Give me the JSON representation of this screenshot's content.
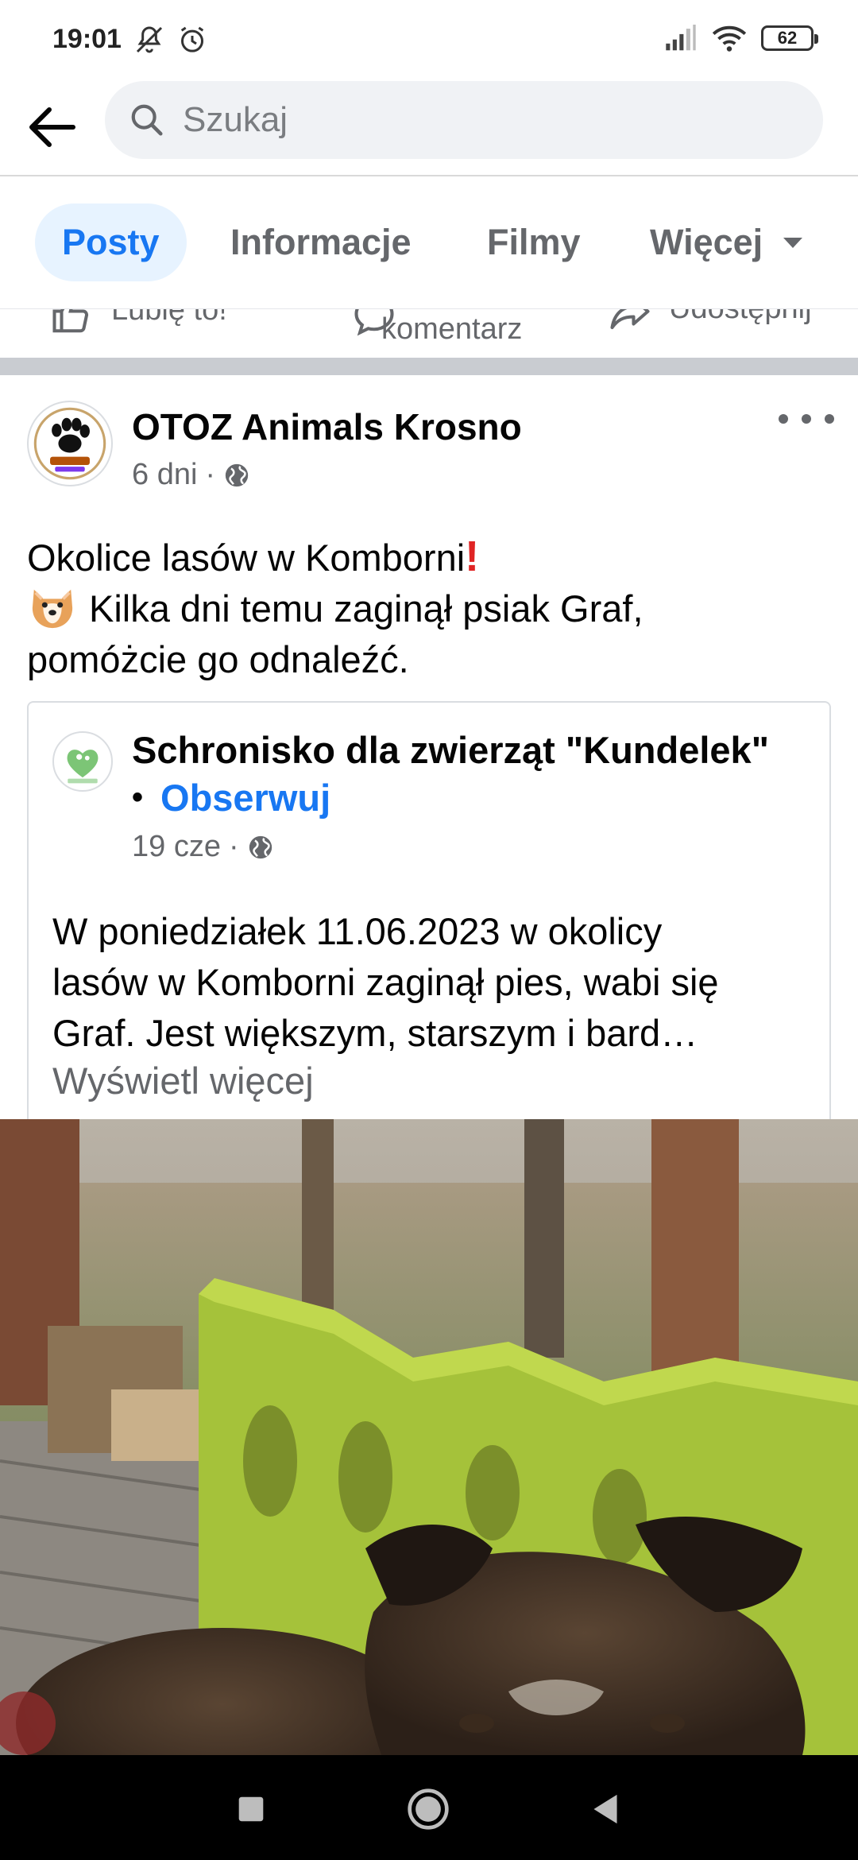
{
  "status_bar": {
    "time": "19:01",
    "battery": "62",
    "icons": [
      "mute-icon",
      "alarm-icon",
      "signal-icon",
      "wifi-icon",
      "battery-icon"
    ]
  },
  "search": {
    "placeholder": "Szukaj"
  },
  "tabs": [
    {
      "label": "Posty",
      "active": true
    },
    {
      "label": "Informacje",
      "active": false
    },
    {
      "label": "Filmy",
      "active": false
    },
    {
      "label": "Więcej",
      "active": false
    }
  ],
  "actions": {
    "like": "Lubię to!",
    "comment": "komentarz",
    "share": "Udostępnij"
  },
  "post": {
    "author": "OTOZ Animals Krosno",
    "time": "6 dni",
    "text_lines": [
      "Okolice lasów w Komborni",
      "Kilka dni temu zaginął psiak Graf,",
      "pomóżcie go odnaleźć."
    ],
    "shared": {
      "author": "Schronisko dla zwierząt \"Kundelek\"",
      "follow": "Obserwuj",
      "separator": "•",
      "time": "19 cze",
      "text_lines": [
        "W poniedziałek 11.06.2023 w okolicy",
        "lasów w Komborni zaginął pies, wabi się",
        "Graf. Jest większym, starszym i bard…"
      ],
      "see_more": "Wyświetl więcej"
    }
  },
  "colors": {
    "accent": "#1877f2",
    "tab_active_bg": "#e7f3ff",
    "secondary_text": "#65676b",
    "search_bg": "#f0f2f5"
  }
}
